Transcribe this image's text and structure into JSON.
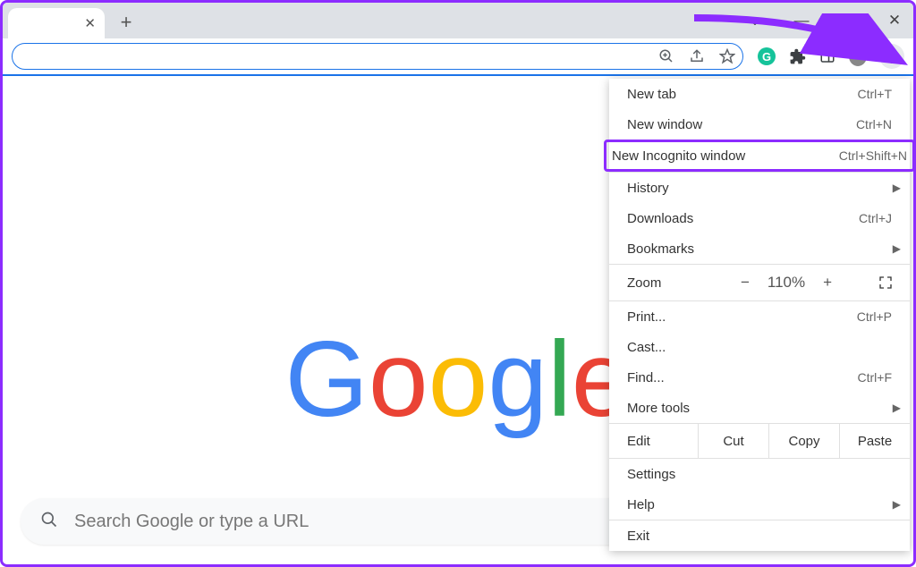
{
  "window": {
    "chevron": "⌄",
    "min": "—",
    "max": "▢",
    "close": "✕"
  },
  "toolbar": {
    "newtab": "+",
    "tab_close": "✕",
    "more": "⋮"
  },
  "omnibox": {
    "placeholder": ""
  },
  "search_placeholder": "Search Google or type a URL",
  "menu": {
    "items": [
      {
        "label": "New tab",
        "shortcut": "Ctrl+T"
      },
      {
        "label": "New window",
        "shortcut": "Ctrl+N"
      },
      {
        "label": "New Incognito window",
        "shortcut": "Ctrl+Shift+N",
        "highlighted": true
      },
      {
        "sep": true
      },
      {
        "label": "History",
        "submenu": true
      },
      {
        "label": "Downloads",
        "shortcut": "Ctrl+J"
      },
      {
        "label": "Bookmarks",
        "submenu": true
      },
      {
        "sep": true
      },
      {
        "zoom": true
      },
      {
        "sep": true
      },
      {
        "label": "Print...",
        "shortcut": "Ctrl+P"
      },
      {
        "label": "Cast..."
      },
      {
        "label": "Find...",
        "shortcut": "Ctrl+F"
      },
      {
        "label": "More tools",
        "submenu": true
      },
      {
        "sep": true
      },
      {
        "edit": true
      },
      {
        "sep": true
      },
      {
        "label": "Settings"
      },
      {
        "label": "Help",
        "submenu": true
      },
      {
        "sep": true
      },
      {
        "label": "Exit"
      }
    ],
    "zoom": {
      "label": "Zoom",
      "minus": "−",
      "value": "110%",
      "plus": "+"
    },
    "edit": {
      "label": "Edit",
      "cut": "Cut",
      "copy": "Copy",
      "paste": "Paste"
    }
  },
  "logo": {
    "g1": "G",
    "o1": "o",
    "o2": "o",
    "g2": "g",
    "l": "l",
    "e": "e"
  }
}
